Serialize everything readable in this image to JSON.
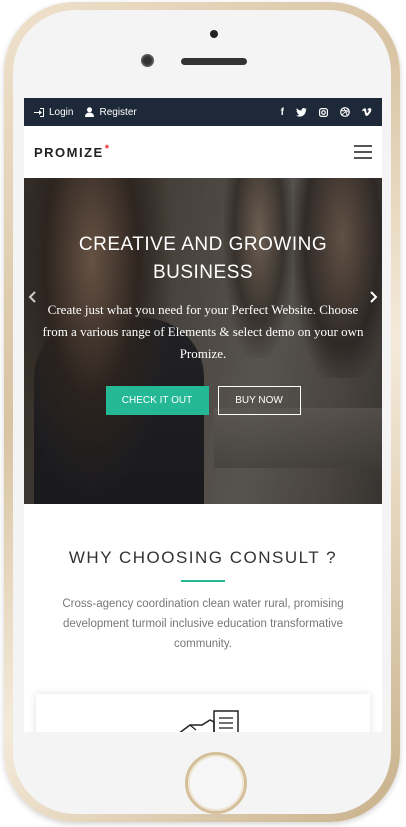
{
  "topbar": {
    "login_label": "Login",
    "register_label": "Register",
    "social": [
      "f",
      "t",
      "ig",
      "dr",
      "v"
    ]
  },
  "nav": {
    "logo": "PROMIZE",
    "logo_mark": "*"
  },
  "hero": {
    "title": "CREATIVE AND GROWING BUSINESS",
    "text": "Create just what you need for your Perfect Website. Choose from a various range of Elements & select demo on your own Promize.",
    "primary_button": "CHECK IT OUT",
    "secondary_button": "BUY NOW",
    "prev_arrow": "‹",
    "next_arrow": "›"
  },
  "why": {
    "title": "WHY CHOOSING CONSULT ?",
    "text": "Cross-agency coordination clean water rural, promising development turmoil inclusive education transformative community."
  },
  "colors": {
    "topbar_bg": "#1d2838",
    "accent": "#25b894",
    "logo_star": "#e5343b"
  }
}
